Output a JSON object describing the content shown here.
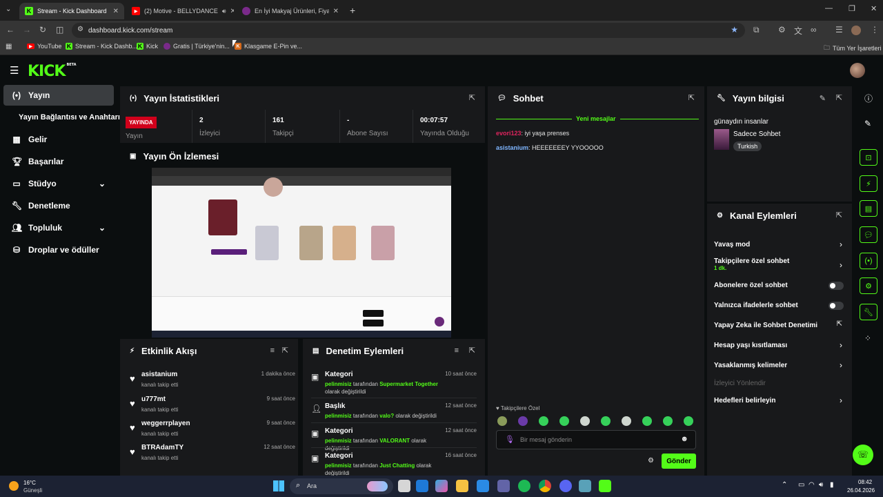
{
  "browser": {
    "tabs": [
      {
        "label": "Stream - Kick Dashboard",
        "active": true
      },
      {
        "label": "(2) Motive - BELLYDANCE",
        "active": false
      },
      {
        "label": "En İyi Makyaj Ürünleri, Fiyatları",
        "active": false
      }
    ],
    "url": "dashboard.kick.com/stream",
    "bookmarks": [
      "YouTube",
      "Stream - Kick Dashb...",
      "Kick",
      "Gratis | Türkiye'nin...",
      "Klasgame E-Pin ve..."
    ],
    "all_bookmarks": "Tüm Yer İşaretleri"
  },
  "app": {
    "logo": "KICK",
    "logo_badge": "BETA",
    "accent": "#53fc18",
    "sidebar": [
      {
        "label": "Yayın",
        "icon": "broadcast-icon",
        "active": true
      },
      {
        "label": "Yayın Bağlantısı ve Anahtarı",
        "icon": "",
        "active": false
      },
      {
        "label": "Gelir",
        "icon": "revenue-icon",
        "active": false
      },
      {
        "label": "Başarılar",
        "icon": "trophy-icon",
        "active": false
      },
      {
        "label": "Stüdyo",
        "icon": "studio-icon",
        "active": false,
        "chevron": true
      },
      {
        "label": "Denetleme",
        "icon": "wrench-icon",
        "active": false
      },
      {
        "label": "Topluluk",
        "icon": "community-icon",
        "active": false,
        "chevron": true
      },
      {
        "label": "Droplar ve ödüller",
        "icon": "drops-icon",
        "active": false
      }
    ],
    "stats": {
      "title": "Yayın İstatistikleri",
      "badge": "YAYINDA",
      "badge_label": "Yayın",
      "cells": [
        {
          "value": "2",
          "label": "İzleyici"
        },
        {
          "value": "161",
          "label": "Takipçi"
        },
        {
          "value": "-",
          "label": "Abone Sayısı"
        },
        {
          "value": "00:07:57",
          "label": "Yayında Olduğu"
        }
      ]
    },
    "preview": {
      "title": "Yayın Ön İzlemesi"
    },
    "activity": {
      "title": "Etkinlik Akışı",
      "items": [
        {
          "name": "asistanium",
          "sub": "kanalı takip etti",
          "time": "1 dakika önce"
        },
        {
          "name": "u777mt",
          "sub": "kanalı takip etti",
          "time": "9 saat önce"
        },
        {
          "name": "weggerrplayen",
          "sub": "kanalı takip etti",
          "time": "9 saat önce"
        },
        {
          "name": "BTRAdamTY",
          "sub": "kanalı takip etti",
          "time": "12 saat önce"
        }
      ]
    },
    "moderation": {
      "title": "Denetim Eylemleri",
      "items": [
        {
          "title": "Kategori",
          "user": "pelinmisiz",
          "mid": "tarafından",
          "value": "Supermarket Together",
          "end": "olarak değiştirildi",
          "time": "10 saat önce"
        },
        {
          "title": "Başlık",
          "user": "pelinmisiz",
          "mid": "tarafından",
          "value": "valo?",
          "end": "olarak değiştirildi",
          "time": "12 saat önce"
        },
        {
          "title": "Kategori",
          "user": "pelinmisiz",
          "mid": "tarafından",
          "value": "VALORANT",
          "end": "olarak değiştirildi",
          "time": "12 saat önce"
        },
        {
          "title": "Kategori",
          "user": "pelinmisiz",
          "mid": "tarafından",
          "value": "Just Chatting",
          "end": "olarak değiştirildi",
          "time": "16 saat önce"
        }
      ]
    },
    "chat": {
      "title": "Sohbet",
      "new_messages": "Yeni mesajlar",
      "messages": [
        {
          "user": "evori123",
          "text": "iyi yaşa prenses",
          "color": "#e0245e"
        },
        {
          "user": "asistanium",
          "text": "HEEEEEEEY YYOOOOO",
          "color": "#7fb6ff"
        }
      ],
      "followers_only": "Takipçilere Özel",
      "placeholder": "Bir mesaj gönderin",
      "send": "Gönder"
    },
    "stream_info": {
      "title": "Yayın bilgisi",
      "stream_title": "günaydın insanlar",
      "category": "Sadece Sohbet",
      "tag": "Turkish"
    },
    "channel_actions": {
      "title": "Kanal Eylemleri",
      "items": [
        {
          "label": "Yavaş mod",
          "control": "chevron"
        },
        {
          "label": "Takipçilere özel sohbet",
          "sub": "1 dk.",
          "control": "chevron"
        },
        {
          "label": "Abonelere özel sohbet",
          "control": "toggle"
        },
        {
          "label": "Yalnızca ifadelerle sohbet",
          "control": "toggle"
        },
        {
          "label": "Yapay Zeka ile Sohbet Denetimi",
          "control": "external"
        },
        {
          "label": "Hesap yaşı kısıtlaması",
          "control": "chevron"
        },
        {
          "label": "Yasaklanmış kelimeler",
          "control": "chevron"
        },
        {
          "label": "İzleyici Yönlendir",
          "control": "none",
          "disabled": true
        },
        {
          "label": "Hedefleri belirleyin",
          "control": "chevron"
        }
      ]
    }
  },
  "taskbar": {
    "weather_temp": "16°C",
    "weather_desc": "Güneşli",
    "search": "Ara",
    "time": "08:42",
    "date": "26.04.2026"
  }
}
